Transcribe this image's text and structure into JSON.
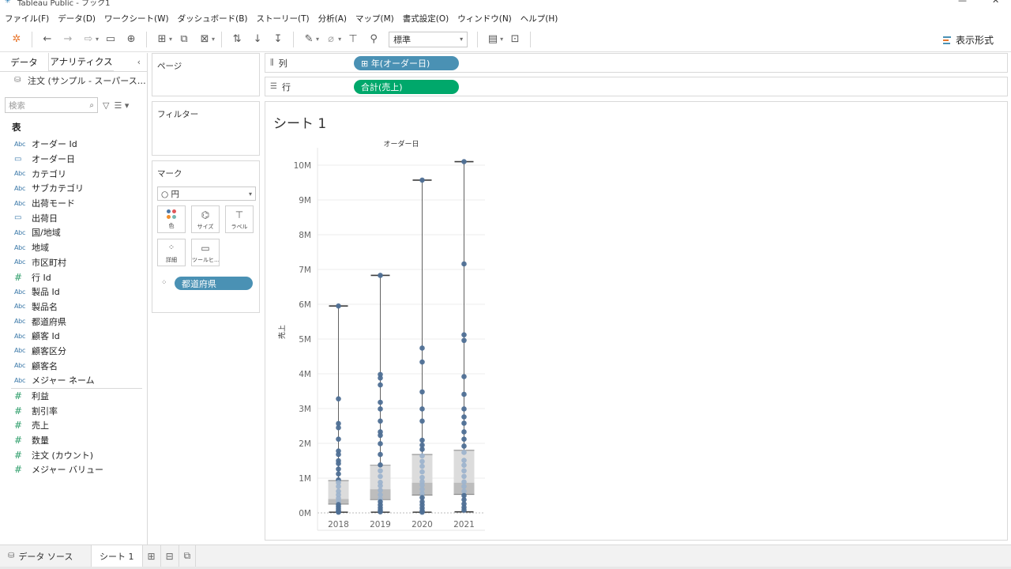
{
  "app": {
    "title": "Tableau Public - ブック1",
    "min": "—",
    "close": "✕"
  },
  "menu": [
    "ファイル(F)",
    "データ(D)",
    "ワークシート(W)",
    "ダッシュボード(B)",
    "ストーリー(T)",
    "分析(A)",
    "マップ(M)",
    "書式設定(O)",
    "ウィンドウ(N)",
    "ヘルプ(H)"
  ],
  "toolbar": {
    "fit": "標準",
    "show_me": "表示形式"
  },
  "data_pane": {
    "tab_data": "データ",
    "tab_analytics": "アナリティクス",
    "source": "注文 (サンプル - スーパース…",
    "search_placeholder": "検索",
    "section": "表",
    "fields": [
      {
        "type": "Abc",
        "name": "オーダー Id"
      },
      {
        "type": "date",
        "name": "オーダー日"
      },
      {
        "type": "Abc",
        "name": "カテゴリ"
      },
      {
        "type": "Abc",
        "name": "サブカテゴリ"
      },
      {
        "type": "Abc",
        "name": "出荷モード"
      },
      {
        "type": "date",
        "name": "出荷日"
      },
      {
        "type": "Abc",
        "name": "国/地域"
      },
      {
        "type": "Abc",
        "name": "地域"
      },
      {
        "type": "Abc",
        "name": "市区町村"
      },
      {
        "type": "#",
        "name": "行 Id"
      },
      {
        "type": "Abc",
        "name": "製品 Id"
      },
      {
        "type": "Abc",
        "name": "製品名"
      },
      {
        "type": "Abc",
        "name": "都道府県"
      },
      {
        "type": "Abc",
        "name": "顧客 Id"
      },
      {
        "type": "Abc",
        "name": "顧客区分"
      },
      {
        "type": "Abc",
        "name": "顧客名"
      },
      {
        "type": "Abc",
        "name": "メジャー ネーム"
      }
    ],
    "measures": [
      {
        "type": "#",
        "name": "利益"
      },
      {
        "type": "#",
        "name": "割引率"
      },
      {
        "type": "#",
        "name": "売上"
      },
      {
        "type": "#",
        "name": "数量"
      },
      {
        "type": "#",
        "name": "注文 (カウント)"
      },
      {
        "type": "#",
        "name": "メジャー バリュー"
      }
    ]
  },
  "cards": {
    "pages": "ページ",
    "filters": "フィルター",
    "marks": "マーク",
    "mark_type": "○ 円",
    "btn_color": "色",
    "btn_size": "サイズ",
    "btn_label": "ラベル",
    "btn_detail": "詳細",
    "btn_tooltip": "ツールヒ…",
    "detail_pill": "都道府県"
  },
  "shelves": {
    "columns_label": "列",
    "columns_pill": "⊞ 年(オーダー日)",
    "rows_label": "行",
    "rows_pill": "合計(売上)"
  },
  "sheet": {
    "title": "シート 1"
  },
  "chart_data": {
    "type": "scatter",
    "subtype": "box-plot",
    "title": "",
    "column_header": "オーダー日",
    "xlabel": "",
    "ylabel": "売上",
    "categories": [
      "2018",
      "2019",
      "2020",
      "2021"
    ],
    "ylim": [
      0,
      10500000
    ],
    "yticks": [
      0,
      1000000,
      2000000,
      3000000,
      4000000,
      5000000,
      6000000,
      7000000,
      8000000,
      9000000,
      10000000
    ],
    "ytick_labels": [
      "0M",
      "1M",
      "2M",
      "3M",
      "4M",
      "5M",
      "6M",
      "7M",
      "8M",
      "9M",
      "10M"
    ],
    "boxes": [
      {
        "category": "2018",
        "min": 20000,
        "q1": 250000,
        "median": 400000,
        "q3": 930000,
        "max": 5950000
      },
      {
        "category": "2019",
        "min": 20000,
        "q1": 380000,
        "median": 680000,
        "q3": 1370000,
        "max": 6830000
      },
      {
        "category": "2020",
        "min": 20000,
        "q1": 510000,
        "median": 870000,
        "q3": 1680000,
        "max": 9570000
      },
      {
        "category": "2021",
        "min": 30000,
        "q1": 530000,
        "median": 870000,
        "q3": 1800000,
        "max": 10100000
      }
    ],
    "points": [
      [
        5950000,
        3280000,
        2570000,
        2450000,
        2120000,
        1780000,
        1680000,
        1500000,
        1420000,
        1260000,
        1120000,
        950000,
        870000,
        760000,
        620000,
        520000,
        420000,
        330000,
        240000,
        180000,
        120000,
        70000,
        40000,
        20000
      ],
      [
        6830000,
        3980000,
        3880000,
        3680000,
        3180000,
        2990000,
        2640000,
        2330000,
        2230000,
        1990000,
        1680000,
        1380000,
        1210000,
        1050000,
        880000,
        780000,
        650000,
        520000,
        400000,
        320000,
        230000,
        150000,
        80000,
        30000
      ],
      [
        9570000,
        4740000,
        4340000,
        3480000,
        2990000,
        2640000,
        2090000,
        1950000,
        1830000,
        1640000,
        1480000,
        1340000,
        1180000,
        1020000,
        900000,
        800000,
        680000,
        560000,
        440000,
        320000,
        230000,
        140000,
        60000,
        20000
      ],
      [
        10100000,
        7160000,
        5120000,
        4960000,
        3920000,
        3410000,
        2990000,
        2760000,
        2580000,
        2330000,
        2120000,
        1920000,
        1740000,
        1510000,
        1370000,
        1210000,
        1050000,
        890000,
        760000,
        620000,
        500000,
        380000,
        260000,
        160000,
        80000
      ]
    ],
    "colors": {
      "point": "#4e6f95",
      "point_light": "#9db3cc",
      "box_upper": "#dcdcdc",
      "box_lower": "#bdbdbd",
      "whisker": "#3b3b3b"
    },
    "grid": true
  }
}
